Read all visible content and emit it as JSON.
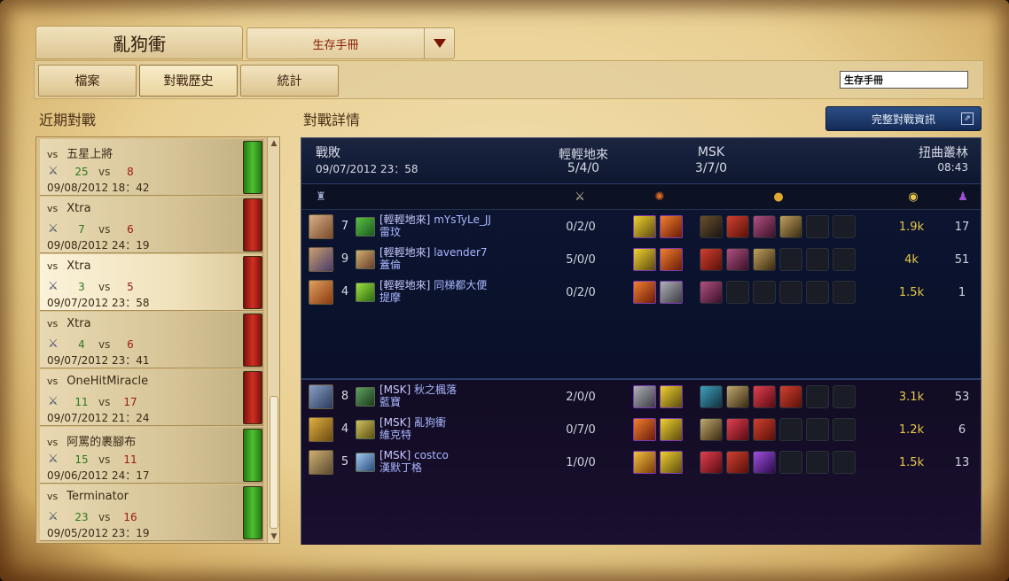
{
  "header": {
    "summoner_name": "亂狗衝",
    "season_select": "生存手冊",
    "tabs": [
      "檔案",
      "對戰歷史",
      "統計"
    ],
    "active_tab": 1,
    "search_value": "生存手冊"
  },
  "left": {
    "title": "近期對戰",
    "matches": [
      {
        "vs_label": "vs",
        "opponent": "五星上將",
        "kills": "25",
        "vs2": "vs",
        "deaths": "8",
        "date": "09/08/2012 18：42",
        "result": "win"
      },
      {
        "vs_label": "vs",
        "opponent": "Xtra",
        "kills": "7",
        "vs2": "vs",
        "deaths": "6",
        "date": "09/08/2012 24：19",
        "result": "loss"
      },
      {
        "vs_label": "vs",
        "opponent": "Xtra",
        "kills": "3",
        "vs2": "vs",
        "deaths": "5",
        "date": "09/07/2012 23：58",
        "result": "loss"
      },
      {
        "vs_label": "vs",
        "opponent": "Xtra",
        "kills": "4",
        "vs2": "vs",
        "deaths": "6",
        "date": "09/07/2012 23：41",
        "result": "loss"
      },
      {
        "vs_label": "vs",
        "opponent": "OneHitMiracle",
        "kills": "11",
        "vs2": "vs",
        "deaths": "17",
        "date": "09/07/2012 21：24",
        "result": "loss"
      },
      {
        "vs_label": "vs",
        "opponent": "阿罵的裹腳布",
        "kills": "15",
        "vs2": "vs",
        "deaths": "11",
        "date": "09/06/2012 24：17",
        "result": "win"
      },
      {
        "vs_label": "vs",
        "opponent": "Terminator",
        "kills": "23",
        "vs2": "vs",
        "deaths": "16",
        "date": "09/05/2012 23：19",
        "result": "win"
      }
    ],
    "selected_index": 2
  },
  "right": {
    "title": "對戰詳情",
    "full_button": "完整對戰資訊",
    "result": "戰敗",
    "datetime": "09/07/2012 23：58",
    "team1_name": "輕輕地來",
    "team1_score": "5/4/0",
    "team2_name": "MSK",
    "team2_score": "3/7/0",
    "map": "扭曲叢林",
    "duration": "08:43",
    "team1": [
      {
        "level": "7",
        "team_tag": "[輕輕地來]",
        "player": "mYsTyLe_JJ",
        "champion": "雷玟",
        "kda": "0/2/0",
        "gold": "1.9k",
        "cs": "17"
      },
      {
        "level": "9",
        "team_tag": "[輕輕地來]",
        "player": "lavender7",
        "champion": "蓋倫",
        "kda": "5/0/0",
        "gold": "4k",
        "cs": "51"
      },
      {
        "level": "4",
        "team_tag": "[輕輕地來]",
        "player": "同梯都大便",
        "champion": "提摩",
        "kda": "0/2/0",
        "gold": "1.5k",
        "cs": "1"
      }
    ],
    "team2": [
      {
        "level": "8",
        "team_tag": "[MSK]",
        "player": "秋之楓落",
        "champion": "藍寶",
        "kda": "2/0/0",
        "gold": "3.1k",
        "cs": "53"
      },
      {
        "level": "4",
        "team_tag": "[MSK]",
        "player": "亂狗衝",
        "champion": "維克特",
        "kda": "0/7/0",
        "gold": "1.2k",
        "cs": "6"
      },
      {
        "level": "5",
        "team_tag": "[MSK]",
        "player": "costco",
        "champion": "漢默丁格",
        "kda": "1/0/0",
        "gold": "1.5k",
        "cs": "13"
      }
    ]
  },
  "icons": {
    "champion_header": "champion-icon",
    "kda_header": "crossed-swords-icon",
    "spells_header": "fire-icon",
    "items_header": "gold-bag-icon",
    "gold_header": "gold-coins-icon",
    "cs_header": "minion-icon"
  },
  "colors": {
    "win": "#3fa82a",
    "loss": "#c02818",
    "gold_text": "#e8c84a",
    "player_name": "#a9b8ff",
    "kill_count": "#2c7a20",
    "death_count": "#9a1a10"
  }
}
